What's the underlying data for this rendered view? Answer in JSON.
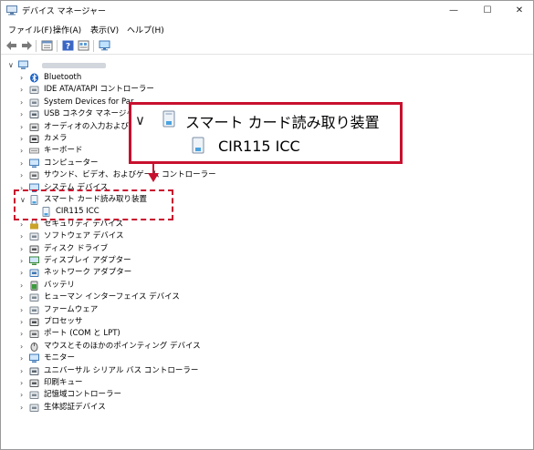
{
  "window": {
    "title": "デバイス マネージャー",
    "minimize": "—",
    "maximize": "☐",
    "close": "✕"
  },
  "menu": [
    "ファイル(F)",
    "操作(A)",
    "表示(V)",
    "ヘルプ(H)"
  ],
  "toolbar_icons": [
    "back-icon",
    "forward-icon",
    "properties-icon",
    "help-icon",
    "view-icon",
    "monitor-icon"
  ],
  "tree": {
    "root_chevron": "∨",
    "root_label_blurred": true,
    "items": [
      {
        "label": "Bluetooth",
        "icon": "bluetooth-icon",
        "chev": "›"
      },
      {
        "label": "IDE ATA/ATAPI コントローラー",
        "icon": "ide-icon",
        "chev": "›"
      },
      {
        "label": "System Devices for Par",
        "icon": "system-icon",
        "chev": "›"
      },
      {
        "label": "USB コネクタ マネージャー",
        "icon": "usb-icon",
        "chev": "›"
      },
      {
        "label": "オーディオの入力および出",
        "icon": "audio-icon",
        "chev": "›"
      },
      {
        "label": "カメラ",
        "icon": "camera-icon",
        "chev": "›"
      },
      {
        "label": "キーボード",
        "icon": "keyboard-icon",
        "chev": "›"
      },
      {
        "label": "コンピューター",
        "icon": "computer-icon",
        "chev": "›"
      },
      {
        "label": "サウンド、ビデオ、およびゲーム コントローラー",
        "icon": "sound-icon",
        "chev": "›"
      },
      {
        "label": "システム デバイス",
        "icon": "system-device-icon",
        "chev": "›"
      },
      {
        "label": "スマート カード読み取り装置",
        "icon": "smartcard-reader-icon",
        "chev": "∨"
      },
      {
        "label": "CIR115 ICC",
        "icon": "smartcard-device-icon",
        "chev": "",
        "child": true
      },
      {
        "label": "セキュリティ デバイス",
        "icon": "security-icon",
        "chev": "›"
      },
      {
        "label": "ソフトウェア デバイス",
        "icon": "software-icon",
        "chev": "›"
      },
      {
        "label": "ディスク ドライブ",
        "icon": "disk-icon",
        "chev": "›"
      },
      {
        "label": "ディスプレイ アダプター",
        "icon": "display-icon",
        "chev": "›"
      },
      {
        "label": "ネットワーク アダプター",
        "icon": "network-icon",
        "chev": "›"
      },
      {
        "label": "バッテリ",
        "icon": "battery-icon",
        "chev": "›"
      },
      {
        "label": "ヒューマン インターフェイス デバイス",
        "icon": "hid-icon",
        "chev": "›"
      },
      {
        "label": "ファームウェア",
        "icon": "firmware-icon",
        "chev": "›"
      },
      {
        "label": "プロセッサ",
        "icon": "processor-icon",
        "chev": "›"
      },
      {
        "label": "ポート (COM と LPT)",
        "icon": "port-icon",
        "chev": "›"
      },
      {
        "label": "マウスとそのほかのポインティング デバイス",
        "icon": "mouse-icon",
        "chev": "›"
      },
      {
        "label": "モニター",
        "icon": "monitor-icon",
        "chev": "›"
      },
      {
        "label": "ユニバーサル シリアル バス コントローラー",
        "icon": "usb-controller-icon",
        "chev": "›"
      },
      {
        "label": "印刷キュー",
        "icon": "print-icon",
        "chev": "›"
      },
      {
        "label": "記憶域コントローラー",
        "icon": "storage-icon",
        "chev": "›"
      },
      {
        "label": "生体認証デバイス",
        "icon": "biometric-icon",
        "chev": "›"
      }
    ]
  },
  "callout": {
    "chevron": "∨",
    "parent_label": "スマート カード読み取り装置",
    "child_label": "CIR115 ICC"
  },
  "colors": {
    "highlight_red": "#c8102e"
  }
}
